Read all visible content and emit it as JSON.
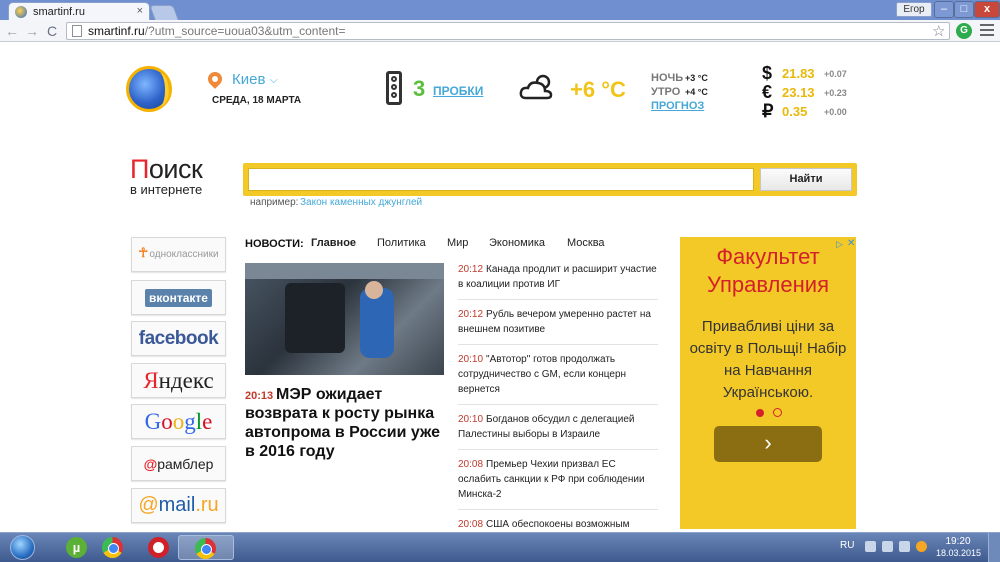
{
  "browser": {
    "tab_title": "smartinf.ru",
    "tab_close": "×",
    "user_name": "Егор",
    "win_min": "–",
    "win_max": "□",
    "win_close": "x",
    "url_domain": "smartinf.ru",
    "url_rest": "/?utm_source=uoua03&utm_content=",
    "nav_back": "←",
    "nav_forward": "→",
    "nav_reload": "C",
    "star": "☆",
    "ext": "G"
  },
  "header": {
    "city": "Киев",
    "city_chevron": "⌵",
    "date": "СРЕДА, 18 МАРТА",
    "traffic_score": "3",
    "traffic_label": "ПРОБКИ",
    "temperature": "+6 °C",
    "night_label": "НОЧЬ",
    "night_value": "+3 °C",
    "morning_label": "УТРО",
    "morning_value": "+4 °C",
    "forecast_label": "ПРОГНОЗ",
    "currencies": [
      {
        "symbol": "$",
        "value": "21.83",
        "change": "+0.07"
      },
      {
        "symbol": "€",
        "value": "23.13",
        "change": "+0.23"
      },
      {
        "symbol": "₽",
        "value": "0.35",
        "change": "+0.00"
      }
    ]
  },
  "search": {
    "logo_first": "П",
    "logo_rest": "оиск",
    "logo_sub": "в интернете",
    "input_value": "",
    "button_label": "Найти",
    "example_label": "например:",
    "example_link": "Закон каменных джунглей"
  },
  "services": {
    "ok": "одноклассники",
    "ok_icon": "☥",
    "vk": "вконтакте",
    "facebook": "facebook",
    "yandex_first": "Я",
    "yandex_rest": "ндекс",
    "google": "Google",
    "rambler_first": "@",
    "rambler_rest": "рамблер",
    "mail_first": "@",
    "mail_mid": "mail",
    "mail_last": ".ru"
  },
  "news": {
    "label": "НОВОСТИ:",
    "tabs": [
      "Главное",
      "Политика",
      "Мир",
      "Экономика",
      "Москва"
    ],
    "featured_time": "20:13",
    "featured_title": "МЭР ожидает возврата к росту рынка автопрома в России уже в 2016 году",
    "items": [
      {
        "time": "20:12",
        "text": "Канада продлит и расширит участие в коалиции против ИГ"
      },
      {
        "time": "20:12",
        "text": "Рубль вечером умеренно растет на внешнем позитиве"
      },
      {
        "time": "20:10",
        "text": "\"Автотор\" готов продолжать сотрудничество с GM, если концерн вернется"
      },
      {
        "time": "20:10",
        "text": "Богданов обсудил с делегацией Палестины выборы в Израиле"
      },
      {
        "time": "20:08",
        "text": "Премьер Чехии призвал ЕС ослабить санкции к РФ при соблюдении Минска-2"
      },
      {
        "time": "20:08",
        "text": "США обеспокоены возможным размещением ядерного оружия России в"
      }
    ]
  },
  "ad": {
    "title": "Факультет Управления",
    "body": "Привабливі ціни за освіту в Польщі! Набір на Навчання Українською.",
    "arrow": "›",
    "info_icon": "▷",
    "close_icon": "✕"
  },
  "taskbar": {
    "lang": "RU",
    "time": "19:20",
    "date": "18.03.2015",
    "utorrent_glyph": "µ"
  }
}
